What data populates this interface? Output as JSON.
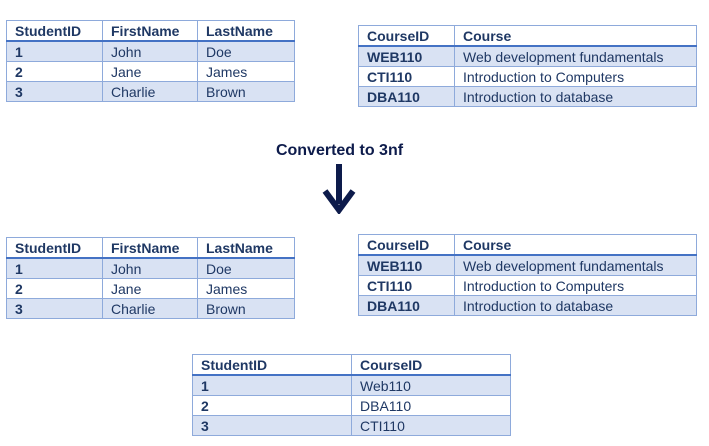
{
  "caption": "Converted to 3nf",
  "top": {
    "students": {
      "headers": [
        "StudentID",
        "FirstName",
        "LastName"
      ],
      "rows": [
        [
          "1",
          "John",
          "Doe"
        ],
        [
          "2",
          "Jane",
          "James"
        ],
        [
          "3",
          "Charlie",
          "Brown"
        ]
      ]
    },
    "courses": {
      "headers": [
        "CourseID",
        "Course"
      ],
      "rows": [
        [
          "WEB110",
          "Web development fundamentals"
        ],
        [
          "CTI110",
          "Introduction to Computers"
        ],
        [
          "DBA110",
          "Introduction to database"
        ]
      ]
    }
  },
  "bottom": {
    "students": {
      "headers": [
        "StudentID",
        "FirstName",
        "LastName"
      ],
      "rows": [
        [
          "1",
          "John",
          "Doe"
        ],
        [
          "2",
          "Jane",
          "James"
        ],
        [
          "3",
          "Charlie",
          "Brown"
        ]
      ]
    },
    "courses": {
      "headers": [
        "CourseID",
        "Course"
      ],
      "rows": [
        [
          "WEB110",
          "Web development fundamentals"
        ],
        [
          "CTI110",
          "Introduction to Computers"
        ],
        [
          "DBA110",
          "Introduction to database"
        ]
      ]
    },
    "enrollment": {
      "headers": [
        "StudentID",
        "CourseID"
      ],
      "rows": [
        [
          "1",
          "Web110"
        ],
        [
          "2",
          "DBA110"
        ],
        [
          "3",
          "CTI110"
        ]
      ]
    }
  },
  "colors": {
    "header_text": "#1f3864",
    "band_fill": "#d9e2f3",
    "border": "#8eaadb",
    "header_rule": "#4472c4",
    "arrow": "#0d1b4b"
  },
  "icons": {
    "arrow": "down-arrow-icon"
  }
}
